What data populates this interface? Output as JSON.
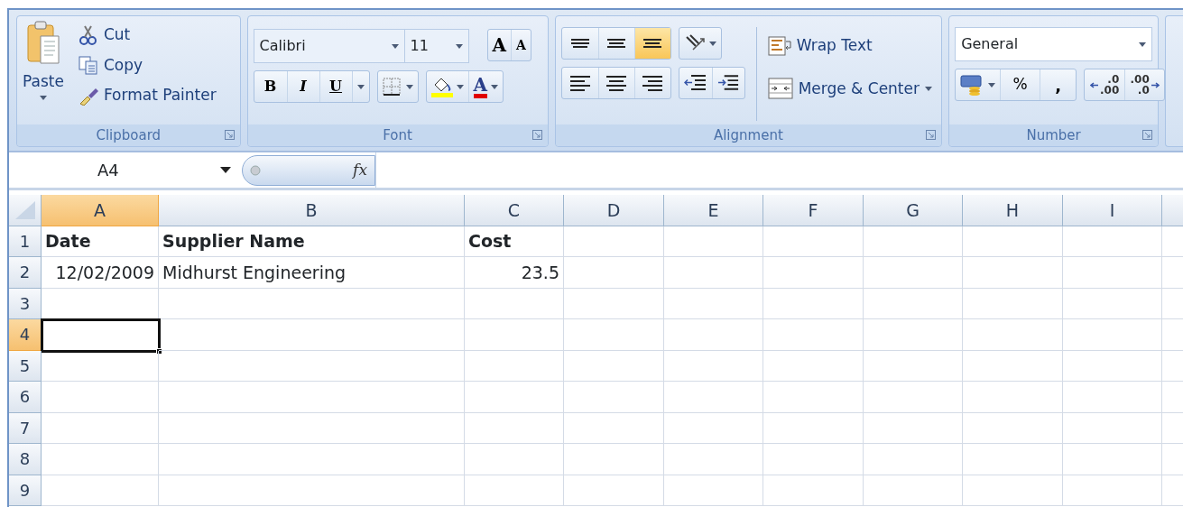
{
  "ribbon": {
    "groups": [
      {
        "kind": "clipboard",
        "label": "Clipboard",
        "paste": "Paste",
        "items": [
          {
            "kind": "cut",
            "label": "Cut"
          },
          {
            "kind": "copy",
            "label": "Copy"
          },
          {
            "kind": "painter",
            "label": "Format Painter"
          }
        ]
      },
      {
        "kind": "font",
        "label": "Font",
        "font_name": "Calibri",
        "font_size": "11",
        "grow": "A",
        "shrink": "A",
        "format_buttons": [
          {
            "kind": "bold",
            "label": "B"
          },
          {
            "kind": "italic",
            "label": "I"
          },
          {
            "kind": "underline",
            "label": "U"
          }
        ],
        "font_color": "A"
      },
      {
        "kind": "alignment",
        "label": "Alignment",
        "vertical": [
          {
            "kind": "top",
            "selected": false
          },
          {
            "kind": "middle",
            "selected": false
          },
          {
            "kind": "bottom",
            "selected": true
          }
        ],
        "wrap_text": "Wrap Text",
        "merge": "Merge & Center"
      },
      {
        "kind": "number",
        "label": "Number",
        "format": "General",
        "percent": "%",
        "comma": ",",
        "decimals": [
          {
            "kind": "increase",
            "top": ".0",
            "bottom": ".00"
          },
          {
            "kind": "decrease",
            "top": ".00",
            "bottom": ".0"
          }
        ]
      }
    ]
  },
  "formula_bar": {
    "cell_ref": "A4",
    "fx": "fx"
  },
  "sheet": {
    "columns": [
      {
        "label": "A",
        "selected": true
      },
      {
        "label": "B",
        "selected": false
      },
      {
        "label": "C",
        "selected": false
      },
      {
        "label": "D",
        "selected": false
      },
      {
        "label": "E",
        "selected": false
      },
      {
        "label": "F",
        "selected": false
      },
      {
        "label": "G",
        "selected": false
      },
      {
        "label": "H",
        "selected": false
      },
      {
        "label": "I",
        "selected": false
      }
    ],
    "rows": [
      {
        "number": "1",
        "selected": false,
        "cells": [
          {
            "text": "Date",
            "bold": true
          },
          {
            "text": "Supplier Name",
            "bold": true
          },
          {
            "text": "Cost",
            "bold": true
          }
        ]
      },
      {
        "number": "2",
        "selected": false,
        "cells": [
          {
            "text": "12/02/2009",
            "kind": "number"
          },
          {
            "text": "Midhurst Engineering",
            "kind": "text"
          },
          {
            "text": "23.5",
            "kind": "number"
          }
        ]
      },
      {
        "number": "3",
        "selected": false
      },
      {
        "number": "4",
        "selected": true
      },
      {
        "number": "5",
        "selected": false
      },
      {
        "number": "6",
        "selected": false
      },
      {
        "number": "7",
        "selected": false
      },
      {
        "number": "8",
        "selected": false
      },
      {
        "number": "9",
        "selected": false
      }
    ]
  }
}
